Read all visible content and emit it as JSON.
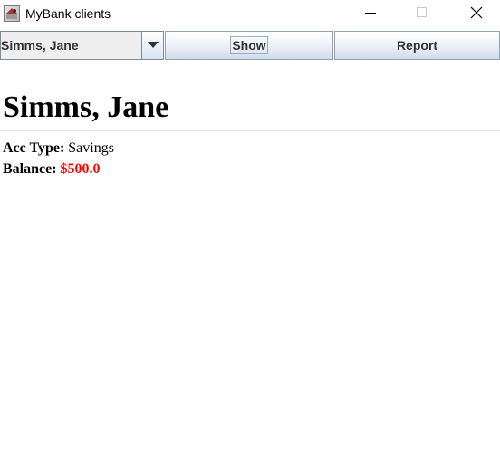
{
  "window": {
    "title": "MyBank clients"
  },
  "toolbar": {
    "client_select_value": "Simms, Jane",
    "show_label": "Show",
    "report_label": "Report"
  },
  "client": {
    "name": "Simms, Jane",
    "acc_type_label": "Acc Type:",
    "acc_type_value": "Savings",
    "balance_label": "Balance:",
    "balance_value": "$500.0"
  },
  "icons": {
    "app": "bank-app-icon",
    "minimize": "minimize-icon",
    "maximize": "maximize-icon",
    "close": "close-icon",
    "dropdown": "chevron-down-icon"
  },
  "colors": {
    "balance": "#ff0000",
    "button_gradient_bottom": "#cfdceb",
    "combo_background": "#eeeeee"
  }
}
